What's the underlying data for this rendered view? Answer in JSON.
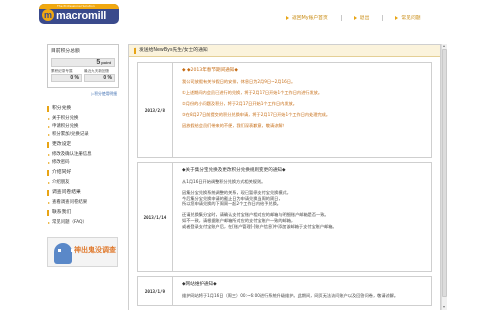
{
  "header": {
    "logo_tagline": "The Professional Solution",
    "logo_text": "macromill",
    "logo_mark": "m",
    "nav": [
      {
        "label": "返回My账户首页"
      },
      {
        "label": "退出"
      },
      {
        "label": "常见问题"
      }
    ]
  },
  "sidebar": {
    "points": {
      "title": "目前积分总额",
      "value": "5",
      "unit": "point",
      "sub_left_label": "累积纪录专属",
      "sub_left_value": "0 %",
      "sub_right_label": "最近九天新回馈",
      "sub_right_value": "0 %",
      "link": "▷积分使用明细"
    },
    "groups": [
      {
        "head": "积分兑换",
        "items": [
          "关于积分兑换",
          "申请积分兑换",
          "积分累加/兑换记录"
        ]
      },
      {
        "head": "更改设定",
        "items": [
          "修改及确认注册信息",
          "修改密码"
        ]
      },
      {
        "head": "介绍同好",
        "items": [
          "介绍朋友"
        ]
      },
      {
        "head": "调查问卷结果",
        "items": [
          "查看调查问卷结果"
        ]
      },
      {
        "head": "联系我们",
        "items": [
          "常见问题（FAQ）"
        ]
      }
    ],
    "promo": {
      "text": "神出鬼没调查"
    }
  },
  "main": {
    "title": "发送给NewBys先生/女士的通知",
    "title_dots": "◦ ◦ ◦",
    "notices": [
      {
        "date": "2013/2/8",
        "heading": "◆ ◆2013年春节期间通知◆",
        "paragraphs": [
          "我公司放假有关节假日的安排，休息日为2月9日~2月16日。",
          "①上述期间内会员已进行的兑换，将于2月17日开始1个工作日内进行发放。",
          "②月份的小问题及积分，将于2月17日开始1个工作日内发放。",
          "③在8月27日前提交的积分兑换申请，将于2月17日开始1个工作日内处理完成。",
          "因放假给会员们带来的不便，我们深表歉意，敬请谅解！"
        ]
      },
      {
        "date": "2013/1/14",
        "heading": "◆关于集分宝兑换及更改积分兑换规则变更的通知◆",
        "paragraphs": [
          "从1月16日开始调整积分兑换方式相关规则。",
          "因集分宝兑换系统调整的关系，现已暂停支付宝兑换模式，\n今后集分宝兑换申请的截止日为申请兑换当周的周日，\n所以您申请兑换的下周周一起2个工作日内给予兑换。",
          "还请兑换集分宝时，请确认支付宝账户相对应的邮箱与明细账户邮箱是否一致。\n如不一致，请根据账户邮箱所对应的支付宝账户一致的邮箱，\n或者登录支付宝账户后，在[账户管理]-[账户信息]中添加该邮箱于支付宝账户邮箱。"
        ]
      },
      {
        "date": "2013/1/9",
        "heading": "◆网站维护通知◆",
        "paragraphs": [
          "维护网站将于1月16日（周三）00:~6:00进行系统升级维护。此期间，网页无法访问账户以及回答问卷，敬请谅解。"
        ]
      }
    ]
  },
  "colors": {
    "accent": "#e8a414",
    "brand": "#3a4a8c",
    "notice_orange": "#c66c14"
  }
}
